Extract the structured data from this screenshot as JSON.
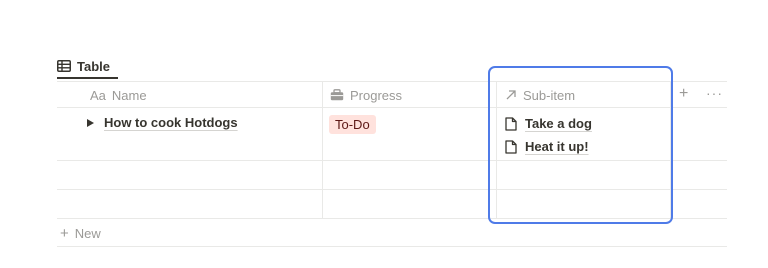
{
  "view": {
    "tab_label": "Table"
  },
  "columns": [
    {
      "label": "Name",
      "prefix": "Aa",
      "icon": "text-icon"
    },
    {
      "label": "Progress",
      "icon": "status-icon"
    },
    {
      "label": "Sub-item",
      "icon": "relation-arrow-icon"
    }
  ],
  "rows": [
    {
      "name": "How to cook Hotdogs",
      "progress": "To-Do",
      "sub_items": [
        "Take a dog",
        "Heat it up!"
      ]
    }
  ],
  "footer": {
    "new_label": "New"
  },
  "colors": {
    "highlight": "#4f7be8",
    "todo_badge_bg": "#ffe2dd",
    "todo_badge_text": "#5d1715"
  }
}
